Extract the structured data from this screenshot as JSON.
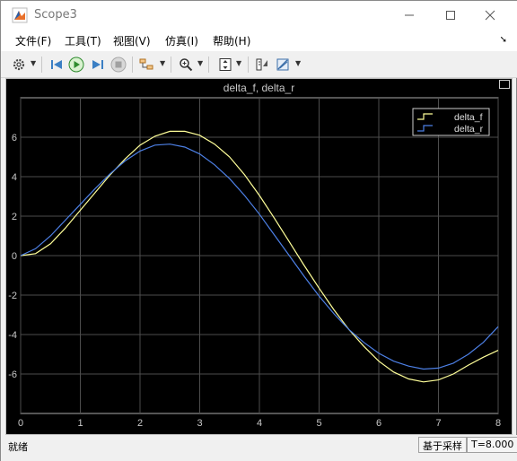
{
  "window": {
    "title": "Scope3"
  },
  "menu": {
    "items": [
      "文件(F)",
      "工具(T)",
      "视图(V)",
      "仿真(I)",
      "帮助(H)"
    ]
  },
  "toolbar": {
    "icons": [
      "gear-icon",
      "step-back-icon",
      "run-icon",
      "step-forward-icon",
      "stop-icon",
      "highlight-block-icon",
      "zoom-icon",
      "scale-axes-icon",
      "cursor-measure-icon",
      "signal-stats-icon"
    ]
  },
  "status": {
    "left": "就绪",
    "mode": "基于采样",
    "time": "T=8.000"
  },
  "colors": {
    "plot_bg": "#000000",
    "axes_bg": "#000000",
    "grid": "#4d4d4d",
    "delta_f": "#ffff99",
    "delta_r": "#4d80e6",
    "text": "#c8c8c8"
  },
  "chart_data": {
    "type": "line",
    "title": "delta_f, delta_r",
    "xlabel": "",
    "ylabel": "",
    "xlim": [
      0,
      8
    ],
    "ylim": [
      -8,
      8
    ],
    "xticks": [
      0,
      1,
      2,
      3,
      4,
      5,
      6,
      7,
      8
    ],
    "yticks": [
      -6,
      -4,
      -2,
      0,
      2,
      4,
      6
    ],
    "grid": true,
    "legend_position": "top-right",
    "series": [
      {
        "name": "delta_f",
        "color": "#ffff99",
        "x": [
          0,
          0.25,
          0.5,
          0.75,
          1,
          1.25,
          1.5,
          1.75,
          2,
          2.25,
          2.5,
          2.75,
          3,
          3.25,
          3.5,
          3.75,
          4,
          4.25,
          4.5,
          4.75,
          5,
          5.25,
          5.5,
          5.75,
          6,
          6.25,
          6.5,
          6.75,
          7,
          7.25,
          7.5,
          7.75,
          8
        ],
        "y": [
          0,
          0.1,
          0.6,
          1.4,
          2.3,
          3.2,
          4.1,
          4.9,
          5.6,
          6.05,
          6.3,
          6.3,
          6.1,
          5.65,
          5.0,
          4.1,
          3.05,
          1.9,
          0.7,
          -0.5,
          -1.65,
          -2.75,
          -3.75,
          -4.6,
          -5.35,
          -5.9,
          -6.25,
          -6.4,
          -6.3,
          -6.0,
          -5.55,
          -5.15,
          -4.8
        ]
      },
      {
        "name": "delta_r",
        "color": "#4d80e6",
        "x": [
          0,
          0.25,
          0.5,
          0.75,
          1,
          1.25,
          1.5,
          1.75,
          2,
          2.25,
          2.5,
          2.75,
          3,
          3.25,
          3.5,
          3.75,
          4,
          4.25,
          4.5,
          4.75,
          5,
          5.25,
          5.5,
          5.75,
          6,
          6.25,
          6.5,
          6.75,
          7,
          7.25,
          7.5,
          7.75,
          8
        ],
        "y": [
          0,
          0.35,
          1.0,
          1.8,
          2.6,
          3.4,
          4.15,
          4.8,
          5.3,
          5.6,
          5.65,
          5.5,
          5.15,
          4.6,
          3.9,
          3.05,
          2.1,
          1.05,
          0.0,
          -1.05,
          -2.05,
          -2.95,
          -3.75,
          -4.4,
          -4.95,
          -5.35,
          -5.6,
          -5.75,
          -5.7,
          -5.45,
          -5.0,
          -4.4,
          -3.6
        ]
      }
    ]
  }
}
